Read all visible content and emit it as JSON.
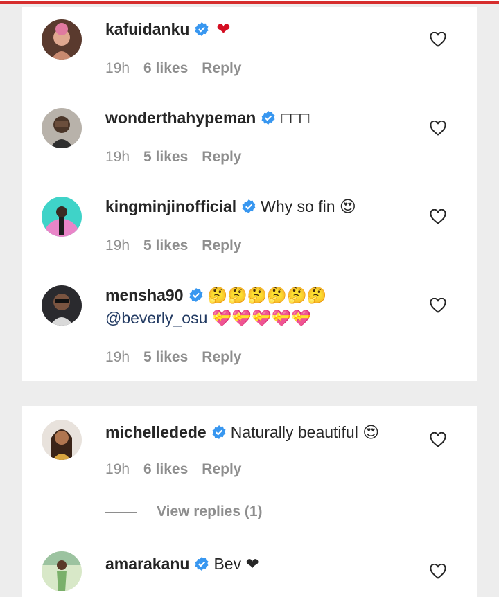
{
  "colors": {
    "accent_red": "#d62d2d",
    "verified_blue": "#3897f0",
    "heart": "#d40e22"
  },
  "comments_group_1": [
    {
      "username": "kafuidanku",
      "text": "❤",
      "time": "19h",
      "likes": "6 likes",
      "reply": "Reply",
      "icons": [
        "verified-badge-icon",
        "red-heart-emoji"
      ]
    },
    {
      "username": "wonderthahypeman",
      "text": "□□□",
      "time": "19h",
      "likes": "5 likes",
      "reply": "Reply",
      "icons": [
        "verified-badge-icon"
      ]
    },
    {
      "username": "kingminjinofficial",
      "text": "Why so fin 😍",
      "time": "19h",
      "likes": "5 likes",
      "reply": "Reply",
      "icons": [
        "verified-badge-icon"
      ]
    },
    {
      "username": "mensha90",
      "text": "🤔🤔🤔🤔🤔🤔",
      "mention": "@beverly_osu",
      "text2": "💝💝💝💝💝",
      "time": "19h",
      "likes": "5 likes",
      "reply": "Reply",
      "icons": [
        "verified-badge-icon"
      ]
    }
  ],
  "comments_group_2": [
    {
      "username": "michelledede",
      "text": "Naturally beautiful 😍",
      "time": "19h",
      "likes": "6 likes",
      "reply": "Reply",
      "view_replies": "View replies (1)",
      "icons": [
        "verified-badge-icon"
      ]
    },
    {
      "username": "amarakanu",
      "text": "Bev ❤",
      "icons": [
        "verified-badge-icon",
        "red-heart-emoji"
      ]
    }
  ]
}
